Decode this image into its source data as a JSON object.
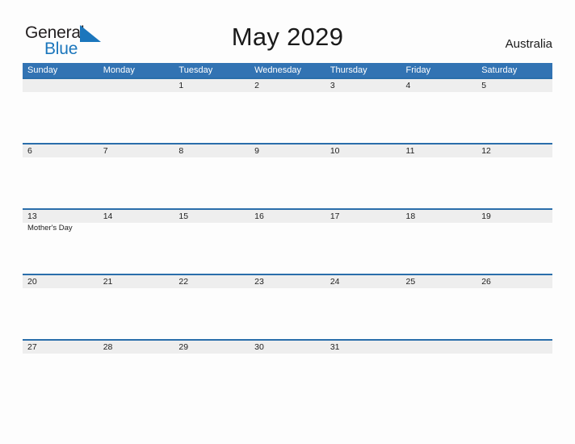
{
  "brand": {
    "name_part1": "General",
    "name_part2": "Blue",
    "flag_icon": "blue-triangle-flag-icon",
    "color_primary": "#1b76bc",
    "color_text": "#231f20"
  },
  "header": {
    "title": "May 2029",
    "country": "Australia"
  },
  "calendar": {
    "month": "May",
    "year": "2029",
    "header_bg": "#3273b3",
    "band_bg": "#eeeeee",
    "band_border": "#2a6eab",
    "weekdays": [
      "Sunday",
      "Monday",
      "Tuesday",
      "Wednesday",
      "Thursday",
      "Friday",
      "Saturday"
    ],
    "weeks": [
      [
        {
          "day": "",
          "event": ""
        },
        {
          "day": "",
          "event": ""
        },
        {
          "day": "1",
          "event": ""
        },
        {
          "day": "2",
          "event": ""
        },
        {
          "day": "3",
          "event": ""
        },
        {
          "day": "4",
          "event": ""
        },
        {
          "day": "5",
          "event": ""
        }
      ],
      [
        {
          "day": "6",
          "event": ""
        },
        {
          "day": "7",
          "event": ""
        },
        {
          "day": "8",
          "event": ""
        },
        {
          "day": "9",
          "event": ""
        },
        {
          "day": "10",
          "event": ""
        },
        {
          "day": "11",
          "event": ""
        },
        {
          "day": "12",
          "event": ""
        }
      ],
      [
        {
          "day": "13",
          "event": "Mother's Day"
        },
        {
          "day": "14",
          "event": ""
        },
        {
          "day": "15",
          "event": ""
        },
        {
          "day": "16",
          "event": ""
        },
        {
          "day": "17",
          "event": ""
        },
        {
          "day": "18",
          "event": ""
        },
        {
          "day": "19",
          "event": ""
        }
      ],
      [
        {
          "day": "20",
          "event": ""
        },
        {
          "day": "21",
          "event": ""
        },
        {
          "day": "22",
          "event": ""
        },
        {
          "day": "23",
          "event": ""
        },
        {
          "day": "24",
          "event": ""
        },
        {
          "day": "25",
          "event": ""
        },
        {
          "day": "26",
          "event": ""
        }
      ],
      [
        {
          "day": "27",
          "event": ""
        },
        {
          "day": "28",
          "event": ""
        },
        {
          "day": "29",
          "event": ""
        },
        {
          "day": "30",
          "event": ""
        },
        {
          "day": "31",
          "event": ""
        },
        {
          "day": "",
          "event": ""
        },
        {
          "day": "",
          "event": ""
        }
      ]
    ]
  }
}
